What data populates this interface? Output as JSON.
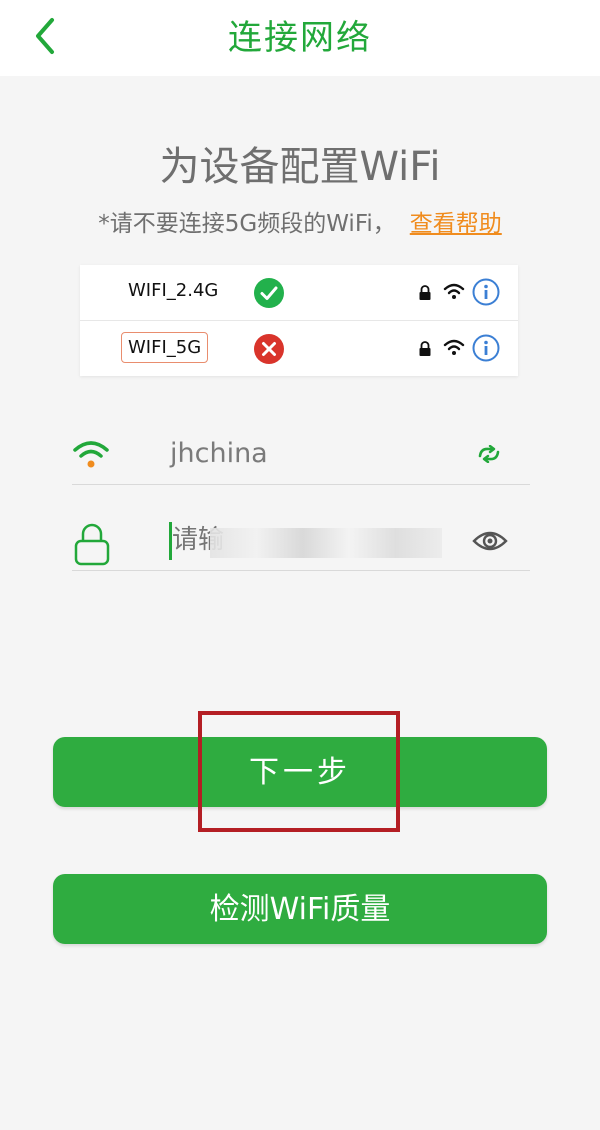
{
  "header": {
    "title": "连接网络",
    "back_icon": "chevron-left-icon"
  },
  "heading": "为设备配置WiFi",
  "notice": {
    "text": "*请不要连接5G频段的WiFi，",
    "help_link": "查看帮助"
  },
  "wifi_examples": [
    {
      "ssid": "WIFI_2.4G",
      "status": "ok",
      "status_icon": "check-circle-icon"
    },
    {
      "ssid": "WIFI_5G",
      "status": "bad",
      "status_icon": "x-circle-icon"
    }
  ],
  "ssid_field": {
    "value": "jhchina",
    "icon": "wifi-icon",
    "action_icon": "refresh-icon"
  },
  "password_field": {
    "placeholder": "请输",
    "icon": "lock-icon",
    "toggle_icon": "eye-icon"
  },
  "buttons": {
    "next": "下一步",
    "check_quality": "检测WiFi质量"
  },
  "colors": {
    "primary": "#2fac40",
    "title": "#22a83a",
    "link": "#f08c1e",
    "ok": "#22b14c",
    "bad": "#d9342b",
    "annotation": "#b41e24"
  }
}
